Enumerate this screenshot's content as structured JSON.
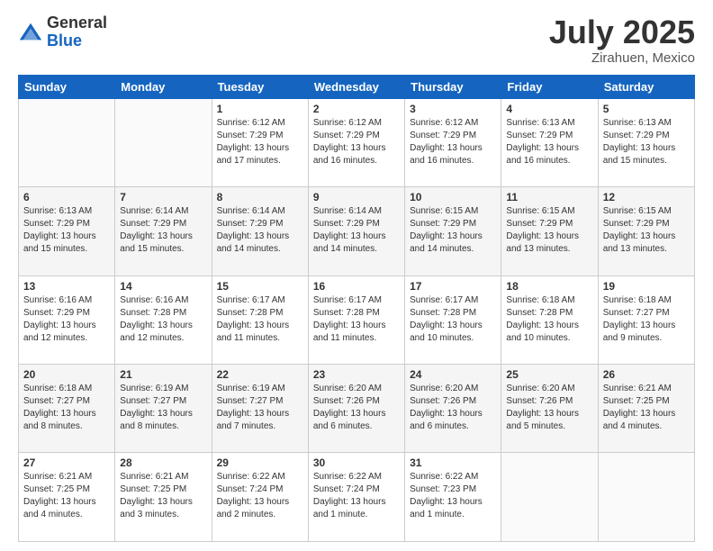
{
  "header": {
    "logo_general": "General",
    "logo_blue": "Blue",
    "month": "July 2025",
    "location": "Zirahuen, Mexico"
  },
  "days_of_week": [
    "Sunday",
    "Monday",
    "Tuesday",
    "Wednesday",
    "Thursday",
    "Friday",
    "Saturday"
  ],
  "weeks": [
    [
      {
        "day": "",
        "sunrise": "",
        "sunset": "",
        "daylight": ""
      },
      {
        "day": "",
        "sunrise": "",
        "sunset": "",
        "daylight": ""
      },
      {
        "day": "1",
        "sunrise": "Sunrise: 6:12 AM",
        "sunset": "Sunset: 7:29 PM",
        "daylight": "Daylight: 13 hours and 17 minutes."
      },
      {
        "day": "2",
        "sunrise": "Sunrise: 6:12 AM",
        "sunset": "Sunset: 7:29 PM",
        "daylight": "Daylight: 13 hours and 16 minutes."
      },
      {
        "day": "3",
        "sunrise": "Sunrise: 6:12 AM",
        "sunset": "Sunset: 7:29 PM",
        "daylight": "Daylight: 13 hours and 16 minutes."
      },
      {
        "day": "4",
        "sunrise": "Sunrise: 6:13 AM",
        "sunset": "Sunset: 7:29 PM",
        "daylight": "Daylight: 13 hours and 16 minutes."
      },
      {
        "day": "5",
        "sunrise": "Sunrise: 6:13 AM",
        "sunset": "Sunset: 7:29 PM",
        "daylight": "Daylight: 13 hours and 15 minutes."
      }
    ],
    [
      {
        "day": "6",
        "sunrise": "Sunrise: 6:13 AM",
        "sunset": "Sunset: 7:29 PM",
        "daylight": "Daylight: 13 hours and 15 minutes."
      },
      {
        "day": "7",
        "sunrise": "Sunrise: 6:14 AM",
        "sunset": "Sunset: 7:29 PM",
        "daylight": "Daylight: 13 hours and 15 minutes."
      },
      {
        "day": "8",
        "sunrise": "Sunrise: 6:14 AM",
        "sunset": "Sunset: 7:29 PM",
        "daylight": "Daylight: 13 hours and 14 minutes."
      },
      {
        "day": "9",
        "sunrise": "Sunrise: 6:14 AM",
        "sunset": "Sunset: 7:29 PM",
        "daylight": "Daylight: 13 hours and 14 minutes."
      },
      {
        "day": "10",
        "sunrise": "Sunrise: 6:15 AM",
        "sunset": "Sunset: 7:29 PM",
        "daylight": "Daylight: 13 hours and 14 minutes."
      },
      {
        "day": "11",
        "sunrise": "Sunrise: 6:15 AM",
        "sunset": "Sunset: 7:29 PM",
        "daylight": "Daylight: 13 hours and 13 minutes."
      },
      {
        "day": "12",
        "sunrise": "Sunrise: 6:15 AM",
        "sunset": "Sunset: 7:29 PM",
        "daylight": "Daylight: 13 hours and 13 minutes."
      }
    ],
    [
      {
        "day": "13",
        "sunrise": "Sunrise: 6:16 AM",
        "sunset": "Sunset: 7:29 PM",
        "daylight": "Daylight: 13 hours and 12 minutes."
      },
      {
        "day": "14",
        "sunrise": "Sunrise: 6:16 AM",
        "sunset": "Sunset: 7:28 PM",
        "daylight": "Daylight: 13 hours and 12 minutes."
      },
      {
        "day": "15",
        "sunrise": "Sunrise: 6:17 AM",
        "sunset": "Sunset: 7:28 PM",
        "daylight": "Daylight: 13 hours and 11 minutes."
      },
      {
        "day": "16",
        "sunrise": "Sunrise: 6:17 AM",
        "sunset": "Sunset: 7:28 PM",
        "daylight": "Daylight: 13 hours and 11 minutes."
      },
      {
        "day": "17",
        "sunrise": "Sunrise: 6:17 AM",
        "sunset": "Sunset: 7:28 PM",
        "daylight": "Daylight: 13 hours and 10 minutes."
      },
      {
        "day": "18",
        "sunrise": "Sunrise: 6:18 AM",
        "sunset": "Sunset: 7:28 PM",
        "daylight": "Daylight: 13 hours and 10 minutes."
      },
      {
        "day": "19",
        "sunrise": "Sunrise: 6:18 AM",
        "sunset": "Sunset: 7:27 PM",
        "daylight": "Daylight: 13 hours and 9 minutes."
      }
    ],
    [
      {
        "day": "20",
        "sunrise": "Sunrise: 6:18 AM",
        "sunset": "Sunset: 7:27 PM",
        "daylight": "Daylight: 13 hours and 8 minutes."
      },
      {
        "day": "21",
        "sunrise": "Sunrise: 6:19 AM",
        "sunset": "Sunset: 7:27 PM",
        "daylight": "Daylight: 13 hours and 8 minutes."
      },
      {
        "day": "22",
        "sunrise": "Sunrise: 6:19 AM",
        "sunset": "Sunset: 7:27 PM",
        "daylight": "Daylight: 13 hours and 7 minutes."
      },
      {
        "day": "23",
        "sunrise": "Sunrise: 6:20 AM",
        "sunset": "Sunset: 7:26 PM",
        "daylight": "Daylight: 13 hours and 6 minutes."
      },
      {
        "day": "24",
        "sunrise": "Sunrise: 6:20 AM",
        "sunset": "Sunset: 7:26 PM",
        "daylight": "Daylight: 13 hours and 6 minutes."
      },
      {
        "day": "25",
        "sunrise": "Sunrise: 6:20 AM",
        "sunset": "Sunset: 7:26 PM",
        "daylight": "Daylight: 13 hours and 5 minutes."
      },
      {
        "day": "26",
        "sunrise": "Sunrise: 6:21 AM",
        "sunset": "Sunset: 7:25 PM",
        "daylight": "Daylight: 13 hours and 4 minutes."
      }
    ],
    [
      {
        "day": "27",
        "sunrise": "Sunrise: 6:21 AM",
        "sunset": "Sunset: 7:25 PM",
        "daylight": "Daylight: 13 hours and 4 minutes."
      },
      {
        "day": "28",
        "sunrise": "Sunrise: 6:21 AM",
        "sunset": "Sunset: 7:25 PM",
        "daylight": "Daylight: 13 hours and 3 minutes."
      },
      {
        "day": "29",
        "sunrise": "Sunrise: 6:22 AM",
        "sunset": "Sunset: 7:24 PM",
        "daylight": "Daylight: 13 hours and 2 minutes."
      },
      {
        "day": "30",
        "sunrise": "Sunrise: 6:22 AM",
        "sunset": "Sunset: 7:24 PM",
        "daylight": "Daylight: 13 hours and 1 minute."
      },
      {
        "day": "31",
        "sunrise": "Sunrise: 6:22 AM",
        "sunset": "Sunset: 7:23 PM",
        "daylight": "Daylight: 13 hours and 1 minute."
      },
      {
        "day": "",
        "sunrise": "",
        "sunset": "",
        "daylight": ""
      },
      {
        "day": "",
        "sunrise": "",
        "sunset": "",
        "daylight": ""
      }
    ]
  ]
}
